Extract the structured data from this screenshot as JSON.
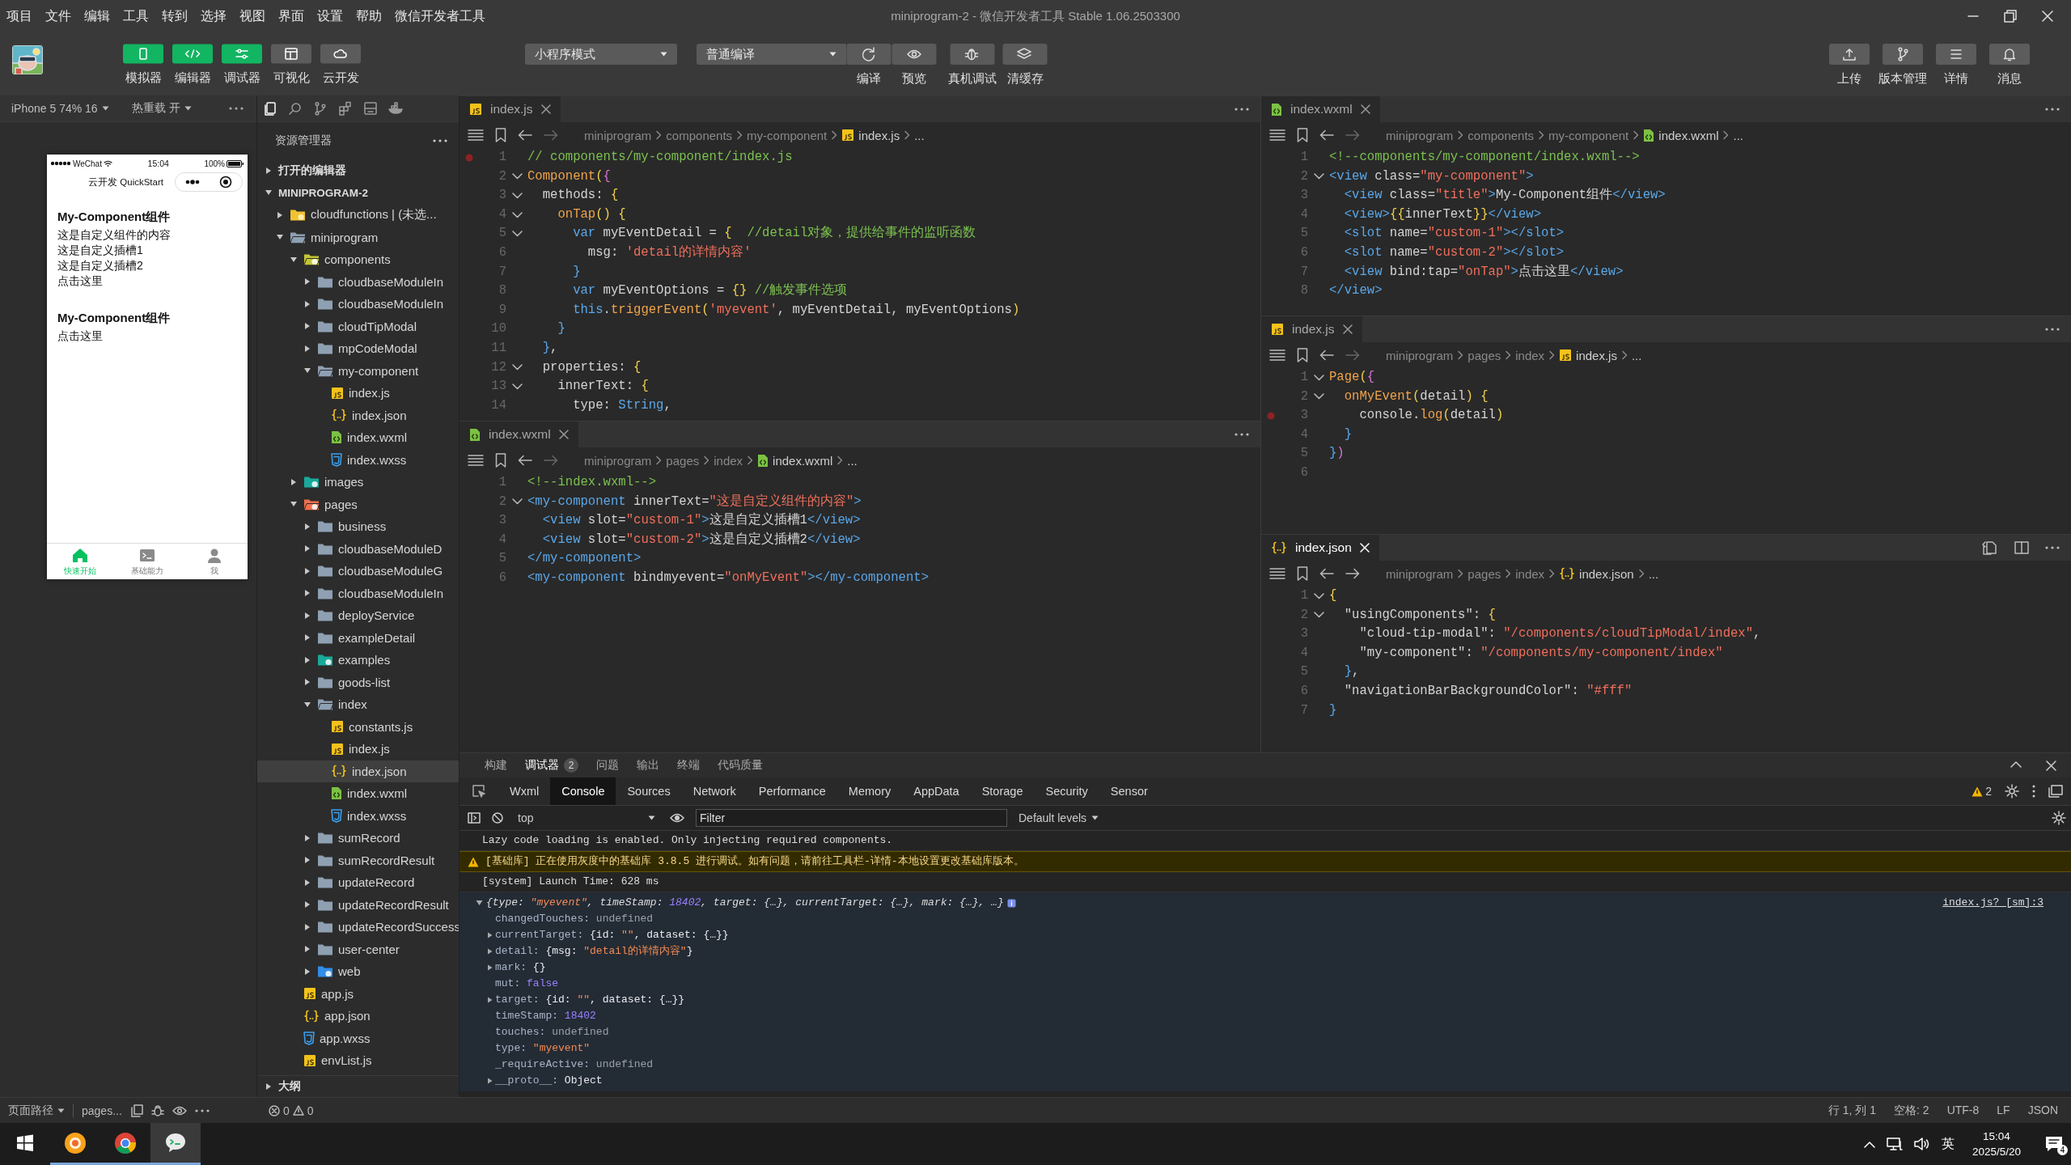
{
  "window": {
    "title": "miniprogram-2 - 微信开发者工具 Stable 1.06.2503300"
  },
  "menu": [
    "项目",
    "文件",
    "编辑",
    "工具",
    "转到",
    "选择",
    "视图",
    "界面",
    "设置",
    "帮助",
    "微信开发者工具"
  ],
  "toolbar": {
    "view_buttons": [
      {
        "label": "模拟器",
        "on": true
      },
      {
        "label": "编辑器",
        "on": true
      },
      {
        "label": "调试器",
        "on": true
      },
      {
        "label": "可视化",
        "on": false
      },
      {
        "label": "云开发",
        "on": false
      }
    ],
    "mode_select": "小程序模式",
    "compile_select": "普通编译",
    "compile_actions": [
      "编译",
      "预览",
      "真机调试",
      "清缓存"
    ],
    "right_buttons": [
      "上传",
      "版本管理",
      "详情",
      "消息"
    ]
  },
  "simulator": {
    "device": "iPhone 5 74% 16",
    "hot_reload": "热重载 开",
    "phone": {
      "carrier": "WeChat",
      "time": "15:04",
      "battery": "100%",
      "nav_title": "云开发 QuickStart",
      "sections": [
        {
          "title": "My-Component组件",
          "lines": [
            "这是自定义组件的内容",
            "这是自定义插槽1",
            "这是自定义插槽2",
            "点击这里"
          ]
        },
        {
          "title": "My-Component组件",
          "lines": [
            "点击这里"
          ]
        }
      ],
      "tabbar": [
        {
          "label": "快速开始",
          "selected": true
        },
        {
          "label": "基础能力",
          "selected": false
        },
        {
          "label": "我",
          "selected": false
        }
      ]
    }
  },
  "explorer": {
    "title": "资源管理器",
    "sections": [
      {
        "label": "打开的编辑器",
        "expanded": false
      },
      {
        "label": "MINIPROGRAM-2",
        "expanded": true
      }
    ],
    "tree": [
      {
        "name": "cloudfunctions | (未选...",
        "kind": "cloud-folder",
        "expanded": false,
        "selected": false
      },
      {
        "name": "miniprogram",
        "kind": "folder",
        "expanded": true,
        "selected": false,
        "children": [
          {
            "name": "components",
            "kind": "component-folder",
            "expanded": true,
            "selected": false,
            "children": [
              {
                "name": "cloudbaseModuleIn",
                "kind": "folder",
                "expanded": false,
                "selected": false
              },
              {
                "name": "cloudbaseModuleIn",
                "kind": "folder",
                "expanded": false,
                "selected": false
              },
              {
                "name": "cloudTipModal",
                "kind": "folder",
                "expanded": false,
                "selected": false
              },
              {
                "name": "mpCodeModal",
                "kind": "folder",
                "expanded": false,
                "selected": false
              },
              {
                "name": "my-component",
                "kind": "folder",
                "expanded": true,
                "selected": false,
                "children": [
                  {
                    "name": "index.js",
                    "kind": "js",
                    "selected": false
                  },
                  {
                    "name": "index.json",
                    "kind": "json",
                    "selected": false
                  },
                  {
                    "name": "index.wxml",
                    "kind": "wxml",
                    "selected": false
                  },
                  {
                    "name": "index.wxss",
                    "kind": "wxss",
                    "selected": false
                  }
                ]
              }
            ]
          },
          {
            "name": "images",
            "kind": "image-folder",
            "expanded": false,
            "selected": false
          },
          {
            "name": "pages",
            "kind": "page-folder",
            "expanded": true,
            "selected": false,
            "children": [
              {
                "name": "business",
                "kind": "folder",
                "expanded": false,
                "selected": false
              },
              {
                "name": "cloudbaseModuleD",
                "kind": "folder",
                "expanded": false,
                "selected": false
              },
              {
                "name": "cloudbaseModuleG",
                "kind": "folder",
                "expanded": false,
                "selected": false
              },
              {
                "name": "cloudbaseModuleIn",
                "kind": "folder",
                "expanded": false,
                "selected": false
              },
              {
                "name": "deployService",
                "kind": "folder",
                "expanded": false,
                "selected": false
              },
              {
                "name": "exampleDetail",
                "kind": "folder",
                "expanded": false,
                "selected": false
              },
              {
                "name": "examples",
                "kind": "image-folder",
                "expanded": false,
                "selected": false
              },
              {
                "name": "goods-list",
                "kind": "folder",
                "expanded": false,
                "selected": false
              },
              {
                "name": "index",
                "kind": "folder",
                "expanded": true,
                "selected": false,
                "children": [
                  {
                    "name": "constants.js",
                    "kind": "js",
                    "selected": false
                  },
                  {
                    "name": "index.js",
                    "kind": "js",
                    "selected": false
                  },
                  {
                    "name": "index.json",
                    "kind": "json",
                    "selected": true
                  },
                  {
                    "name": "index.wxml",
                    "kind": "wxml",
                    "selected": false
                  },
                  {
                    "name": "index.wxss",
                    "kind": "wxss",
                    "selected": false
                  }
                ]
              },
              {
                "name": "sumRecord",
                "kind": "folder",
                "expanded": false,
                "selected": false
              },
              {
                "name": "sumRecordResult",
                "kind": "folder",
                "expanded": false,
                "selected": false
              },
              {
                "name": "updateRecord",
                "kind": "folder",
                "expanded": false,
                "selected": false
              },
              {
                "name": "updateRecordResult",
                "kind": "folder",
                "expanded": false,
                "selected": false
              },
              {
                "name": "updateRecordSuccess",
                "kind": "folder",
                "expanded": false,
                "selected": false
              },
              {
                "name": "user-center",
                "kind": "folder",
                "expanded": false,
                "selected": false
              },
              {
                "name": "web",
                "kind": "web-folder",
                "expanded": false,
                "selected": false
              }
            ]
          },
          {
            "name": "app.js",
            "kind": "js",
            "selected": false
          },
          {
            "name": "app.json",
            "kind": "json",
            "selected": false
          },
          {
            "name": "app.wxss",
            "kind": "wxss",
            "selected": false
          },
          {
            "name": "envList.js",
            "kind": "js",
            "selected": false
          }
        ]
      }
    ],
    "outline": {
      "label": "大纲",
      "expanded": false
    }
  },
  "editor_groups": [
    {
      "editors": [
        {
          "tab": "index.js",
          "kind": "js",
          "focused": false,
          "breadcrumb": [
            "miniprogram",
            "components",
            "my-component",
            "index.js",
            "..."
          ],
          "lines": [
            {
              "n": "1",
              "code": "// components/my-component/index.js",
              "fold": false,
              "breakpoint": true
            },
            {
              "n": "2",
              "code": "Component({",
              "fold": true,
              "breakpoint": false
            },
            {
              "n": "3",
              "code": "  methods: {",
              "fold": true,
              "breakpoint": false
            },
            {
              "n": "4",
              "code": "    onTap() {",
              "fold": true,
              "breakpoint": false
            },
            {
              "n": "5",
              "code": "      var myEventDetail = {  //detail对象，提供给事件的监听函数",
              "fold": true,
              "breakpoint": false
            },
            {
              "n": "6",
              "code": "        msg: 'detail的详情内容'",
              "fold": false,
              "breakpoint": false
            },
            {
              "n": "7",
              "code": "      }",
              "fold": false,
              "breakpoint": false
            },
            {
              "n": "8",
              "code": "      var myEventOptions = {} //触发事件选项",
              "fold": false,
              "breakpoint": false
            },
            {
              "n": "9",
              "code": "      this.triggerEvent('myevent', myEventDetail, myEventOptions)",
              "fold": false,
              "breakpoint": false
            },
            {
              "n": "10",
              "code": "    }",
              "fold": false,
              "breakpoint": false
            },
            {
              "n": "11",
              "code": "  },",
              "fold": false,
              "breakpoint": false
            },
            {
              "n": "12",
              "code": "  properties: {",
              "fold": true,
              "breakpoint": false
            },
            {
              "n": "13",
              "code": "    innerText: {",
              "fold": true,
              "breakpoint": false
            },
            {
              "n": "14",
              "code": "      type: String,",
              "fold": false,
              "breakpoint": false
            }
          ]
        },
        {
          "tab": "index.wxml",
          "kind": "wxml",
          "focused": false,
          "breadcrumb": [
            "miniprogram",
            "pages",
            "index",
            "index.wxml",
            "..."
          ],
          "lines": [
            {
              "n": "1",
              "code": "<!--index.wxml-->",
              "fold": false,
              "breakpoint": false
            },
            {
              "n": "2",
              "code": "<my-component innerText=\"这是自定义组件的内容\">",
              "fold": true,
              "breakpoint": false
            },
            {
              "n": "3",
              "code": "  <view slot=\"custom-1\">这是自定义插槽1</view>",
              "fold": false,
              "breakpoint": false
            },
            {
              "n": "4",
              "code": "  <view slot=\"custom-2\">这是自定义插槽2</view>",
              "fold": false,
              "breakpoint": false
            },
            {
              "n": "5",
              "code": "</my-component>",
              "fold": false,
              "breakpoint": false
            },
            {
              "n": "6",
              "code": "<my-component bindmyevent=\"onMyEvent\"></my-component>",
              "fold": false,
              "breakpoint": false
            }
          ]
        }
      ]
    },
    {
      "editors": [
        {
          "tab": "index.wxml",
          "kind": "wxml",
          "focused": false,
          "breadcrumb": [
            "miniprogram",
            "components",
            "my-component",
            "index.wxml",
            "..."
          ],
          "lines": [
            {
              "n": "1",
              "code": "<!--components/my-component/index.wxml-->",
              "fold": false,
              "breakpoint": false
            },
            {
              "n": "2",
              "code": "<view class=\"my-component\">",
              "fold": true,
              "breakpoint": false
            },
            {
              "n": "3",
              "code": "  <view class=\"title\">My-Component组件</view>",
              "fold": false,
              "breakpoint": false
            },
            {
              "n": "4",
              "code": "  <view>{{innerText}}</view>",
              "fold": false,
              "breakpoint": false
            },
            {
              "n": "5",
              "code": "  <slot name=\"custom-1\"></slot>",
              "fold": false,
              "breakpoint": false
            },
            {
              "n": "6",
              "code": "  <slot name=\"custom-2\"></slot>",
              "fold": false,
              "breakpoint": false
            },
            {
              "n": "7",
              "code": "  <view bind:tap=\"onTap\">点击这里</view>",
              "fold": false,
              "breakpoint": false
            },
            {
              "n": "8",
              "code": "</view>",
              "fold": false,
              "breakpoint": false
            }
          ]
        },
        {
          "tab": "index.js",
          "kind": "js",
          "focused": false,
          "breadcrumb": [
            "miniprogram",
            "pages",
            "index",
            "index.js",
            "..."
          ],
          "lines": [
            {
              "n": "1",
              "code": "Page({",
              "fold": true,
              "breakpoint": false
            },
            {
              "n": "2",
              "code": "  onMyEvent(detail) {",
              "fold": true,
              "breakpoint": false
            },
            {
              "n": "3",
              "code": "    console.log(detail)",
              "fold": false,
              "breakpoint": true
            },
            {
              "n": "4",
              "code": "  }",
              "fold": false,
              "breakpoint": false
            },
            {
              "n": "5",
              "code": "})",
              "fold": false,
              "breakpoint": false
            },
            {
              "n": "6",
              "fold": false,
              "breakpoint": false
            }
          ]
        },
        {
          "tab": "index.json",
          "kind": "json",
          "focused": true,
          "breadcrumb": [
            "miniprogram",
            "pages",
            "index",
            "index.json",
            "..."
          ],
          "lines": [
            {
              "n": "1",
              "code": "{",
              "fold": true,
              "breakpoint": false
            },
            {
              "n": "2",
              "code": "  \"usingComponents\": {",
              "fold": true,
              "breakpoint": false
            },
            {
              "n": "3",
              "code": "    \"cloud-tip-modal\": \"/components/cloudTipModal/index\",",
              "fold": false,
              "breakpoint": false
            },
            {
              "n": "4",
              "code": "    \"my-component\": \"/components/my-component/index\"",
              "fold": false,
              "breakpoint": false
            },
            {
              "n": "5",
              "code": "  },",
              "fold": false,
              "breakpoint": false
            },
            {
              "n": "6",
              "code": "  \"navigationBarBackgroundColor\": \"#fff\"",
              "fold": false,
              "breakpoint": false
            },
            {
              "n": "7",
              "code": "}",
              "fold": false,
              "breakpoint": false
            }
          ]
        }
      ]
    }
  ],
  "panel": {
    "tabs": [
      {
        "label": "构建",
        "selected": false
      },
      {
        "label": "调试器",
        "badge": "2",
        "selected": true
      },
      {
        "label": "问题",
        "selected": false
      },
      {
        "label": "输出",
        "selected": false
      },
      {
        "label": "终端",
        "selected": false
      },
      {
        "label": "代码质量",
        "selected": false
      }
    ],
    "devtools_tabs": [
      {
        "label": "Wxml",
        "selected": false
      },
      {
        "label": "Console",
        "selected": true
      },
      {
        "label": "Sources",
        "selected": false
      },
      {
        "label": "Network",
        "selected": false
      },
      {
        "label": "Performance",
        "selected": false
      },
      {
        "label": "Memory",
        "selected": false
      },
      {
        "label": "AppData",
        "selected": false
      },
      {
        "label": "Storage",
        "selected": false
      },
      {
        "label": "Security",
        "selected": false
      },
      {
        "label": "Sensor",
        "selected": false
      }
    ],
    "warning_count": "2",
    "context": "top",
    "filter_placeholder": "Filter",
    "levels": "Default levels",
    "messages": [
      {
        "kind": "info",
        "text": "Lazy code loading is enabled. Only injecting required components."
      },
      {
        "kind": "warning",
        "text": "[基础库] 正在使用灰度中的基础库 3.8.5 进行调试。如有问题，请前往工具栏-详情-本地设置更改基础库版本。"
      },
      {
        "kind": "info",
        "text": "[system] Launch Time: 628 ms"
      },
      {
        "kind": "object",
        "summary": "{type: \"myevent\", timeStamp: 18402, target: {…}, currentTarget: {…}, mark: {…}, …}",
        "source": "index.js? [sm]:3",
        "expanded": true,
        "properties": [
          {
            "key": "changedTouches:",
            "value": "undefined",
            "kind": "undefined"
          },
          {
            "key": "currentTarget:",
            "value": "{id: \"\", dataset: {…}}",
            "kind": "object"
          },
          {
            "key": "detail:",
            "value": "{msg: \"detail的详情内容\"}",
            "kind": "object"
          },
          {
            "key": "mark:",
            "value": "{}",
            "kind": "object"
          },
          {
            "key": "mut:",
            "value": "false",
            "kind": "boolean"
          },
          {
            "key": "target:",
            "value": "{id: \"\", dataset: {…}}",
            "kind": "object"
          },
          {
            "key": "timeStamp:",
            "value": "18402",
            "kind": "number"
          },
          {
            "key": "touches:",
            "value": "undefined",
            "kind": "undefined"
          },
          {
            "key": "type:",
            "value": "\"myevent\"",
            "kind": "string"
          },
          {
            "key": "_requireActive:",
            "value": "undefined",
            "kind": "undefined"
          },
          {
            "key": "__proto__:",
            "value": "Object",
            "kind": "object"
          }
        ]
      }
    ]
  },
  "status_bar": {
    "page_path_label": "页面路径",
    "page_path": "pages...",
    "errors": "0",
    "warnings": "0",
    "items": [
      "行 1, 列 1",
      "空格: 2",
      "UTF-8",
      "LF",
      "JSON"
    ]
  },
  "taskbar": {
    "apps": [
      {
        "selected": false
      },
      {
        "selected": false
      },
      {
        "selected": true
      }
    ],
    "input_method": "英",
    "time": "15:04",
    "date": "2025/5/20",
    "notifications": "4"
  }
}
